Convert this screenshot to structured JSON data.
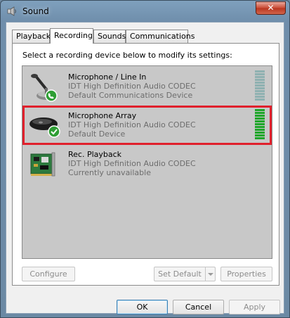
{
  "window": {
    "title": "Sound",
    "title_icon": "speaker-icon",
    "close_glyph": "✕"
  },
  "tabs": [
    {
      "label": "Playback",
      "active": false
    },
    {
      "label": "Recording",
      "active": true
    },
    {
      "label": "Sounds",
      "active": false
    },
    {
      "label": "Communications",
      "active": false
    }
  ],
  "instructions": "Select a recording device below to modify its settings:",
  "devices": [
    {
      "name": "Microphone / Line In",
      "driver": "IDT High Definition Audio CODEC",
      "status": "Default Communications Device",
      "icon": "microphone-icon",
      "badge": "phone-badge-icon",
      "meter_level": 0,
      "selected": false
    },
    {
      "name": "Microphone Array",
      "driver": "IDT High Definition Audio CODEC",
      "status": "Default Device",
      "icon": "microphone-array-icon",
      "badge": "check-badge-icon",
      "meter_level": 1.0,
      "selected": true
    },
    {
      "name": "Rec. Playback",
      "driver": "IDT High Definition Audio CODEC",
      "status": "Currently unavailable",
      "icon": "sound-card-icon",
      "badge": "",
      "meter_level": null,
      "selected": false
    }
  ],
  "buttons": {
    "configure": "Configure",
    "set_default": "Set Default",
    "properties": "Properties",
    "ok": "OK",
    "cancel": "Cancel",
    "apply": "Apply"
  },
  "colors": {
    "selection_outline": "#e0202c",
    "meter_active": "#1ea62a",
    "meter_idle": "#8fb1b1"
  }
}
